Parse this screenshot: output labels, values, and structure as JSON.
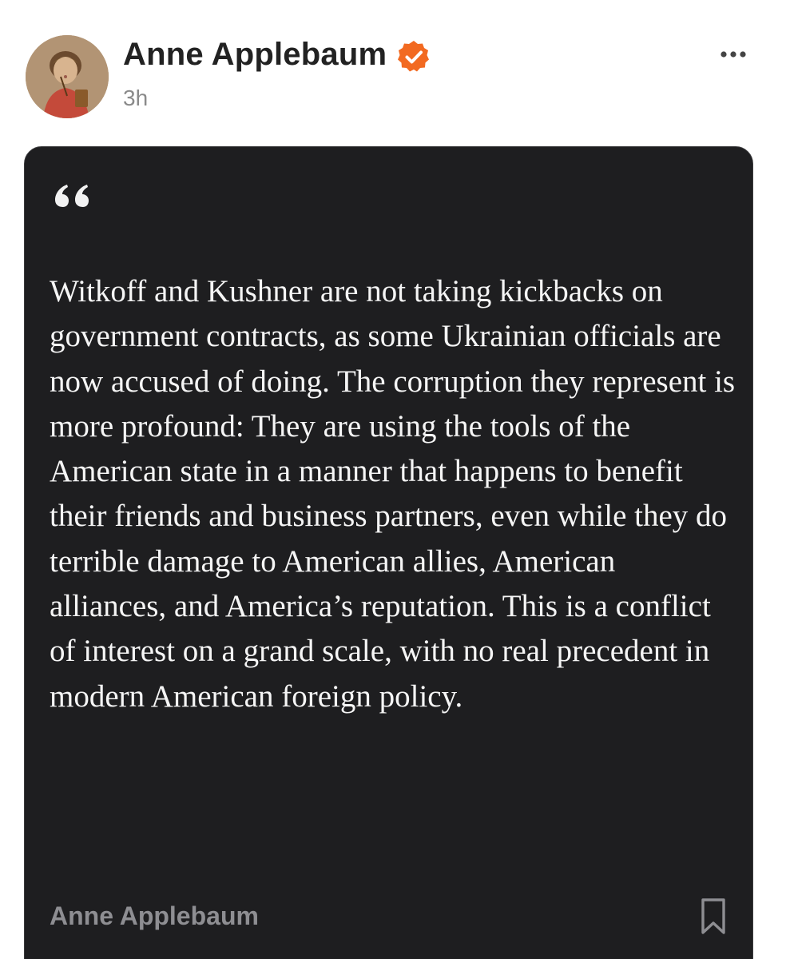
{
  "post": {
    "author": "Anne Applebaum",
    "timestamp": "3h",
    "avatar_icon": "portrait-avatar",
    "verified_icon": "verified-check-icon",
    "more_icon": "more-dots-icon"
  },
  "quote": {
    "icon": "quote-mark-icon",
    "text": "Witkoff and Kushner are not taking kickbacks on government contracts, as some Ukrainian officials are now accused of doing. The corruption they represent is more profound: They are using the tools of the American state in a manner that happens to benefit their friends and business partners, even while they do terrible damage to American allies, American alliances, and America’s reputation. This is a conflict of interest on a grand scale, with no real precedent in modern American foreign policy.",
    "author": "Anne Applebaum",
    "bookmark_icon": "bookmark-icon"
  },
  "colors": {
    "verified_badge": "#f26a21",
    "card_background": "#1e1e20",
    "quote_text": "#f5f5f5",
    "quote_author": "#8e8e92",
    "timestamp": "#8a8a8a",
    "author_name": "#222222"
  }
}
